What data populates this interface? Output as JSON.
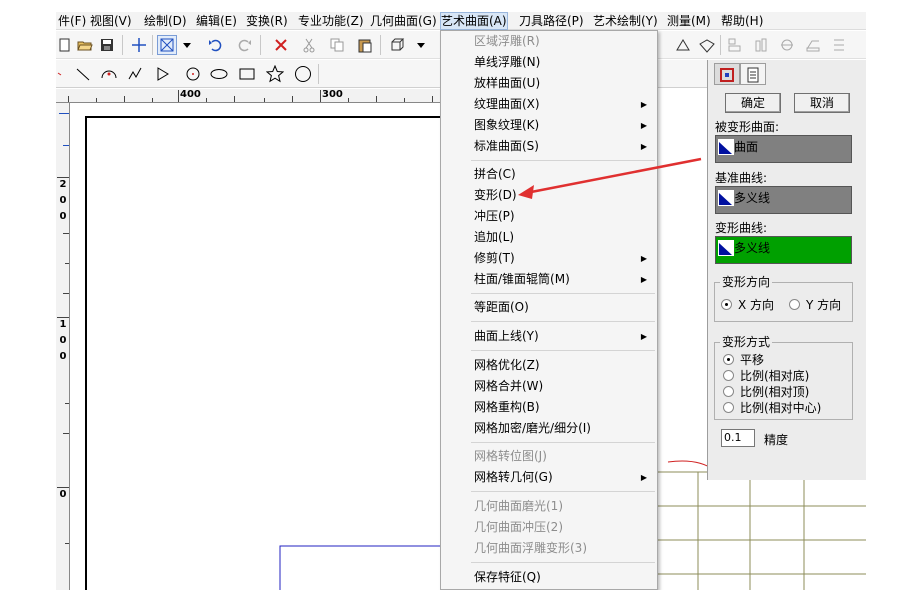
{
  "menubar": {
    "items": [
      {
        "label": "件(F)"
      },
      {
        "label": "视图(V)"
      },
      {
        "label": "绘制(D)"
      },
      {
        "label": "编辑(E)"
      },
      {
        "label": "变换(R)"
      },
      {
        "label": "专业功能(Z)"
      },
      {
        "label": "几何曲面(G)"
      },
      {
        "label": "艺术曲面(A)"
      },
      {
        "label": "刀具路径(P)"
      },
      {
        "label": "艺术绘制(Y)"
      },
      {
        "label": "测量(M)"
      },
      {
        "label": "帮助(H)"
      }
    ]
  },
  "toolbar": {
    "row1_icons": [
      "open-file-icon",
      "save-icon",
      "crosshair-icon",
      "select-box-icon",
      "dropdown-arrow-icon",
      "undo-icon",
      "redo-icon",
      "delete-icon",
      "cut-icon",
      "copy-icon",
      "paste-icon",
      "cube-view-icon",
      "dropdown-arrow-icon"
    ],
    "row2_icons": [
      "line-icon",
      "arc-icon",
      "polyline-icon",
      "polygon-open-icon",
      "circle-dot-icon",
      "ellipse-icon",
      "rectangle-icon",
      "star-icon",
      "circle-icon"
    ]
  },
  "ruler": {
    "top_labels": [
      "400",
      "300"
    ],
    "left_labels": [
      {
        "chars": [
          "2",
          "0",
          "0"
        ]
      },
      {
        "chars": [
          "1",
          "0",
          "0"
        ]
      },
      {
        "chars": [
          "0"
        ]
      }
    ]
  },
  "dropdown": {
    "items": [
      {
        "label": "区域浮雕(R)",
        "disabled": true,
        "submenu": false
      },
      {
        "label": "单线浮雕(N)",
        "disabled": false,
        "submenu": false
      },
      {
        "label": "放样曲面(U)",
        "disabled": false,
        "submenu": false
      },
      {
        "label": "纹理曲面(X)",
        "disabled": false,
        "submenu": true
      },
      {
        "label": "图象纹理(K)",
        "disabled": false,
        "submenu": true
      },
      {
        "label": "标准曲面(S)",
        "disabled": false,
        "submenu": true
      },
      {
        "label": "拼合(C)",
        "disabled": false,
        "submenu": false
      },
      {
        "label": "变形(D)",
        "disabled": false,
        "submenu": false
      },
      {
        "label": "冲压(P)",
        "disabled": false,
        "submenu": false
      },
      {
        "label": "追加(L)",
        "disabled": false,
        "submenu": false
      },
      {
        "label": "修剪(T)",
        "disabled": false,
        "submenu": true
      },
      {
        "label": "柱面/锥面辊筒(M)",
        "disabled": false,
        "submenu": true
      },
      {
        "label": "等距面(O)",
        "disabled": false,
        "submenu": false
      },
      {
        "label": "曲面上线(Y)",
        "disabled": false,
        "submenu": true
      },
      {
        "label": "网格优化(Z)",
        "disabled": false,
        "submenu": false
      },
      {
        "label": "网格合并(W)",
        "disabled": false,
        "submenu": false
      },
      {
        "label": "网格重构(B)",
        "disabled": false,
        "submenu": false
      },
      {
        "label": "网格加密/磨光/细分(I)",
        "disabled": false,
        "submenu": false
      },
      {
        "label": "网格转位图(J)",
        "disabled": true,
        "submenu": false
      },
      {
        "label": "网格转几何(G)",
        "disabled": false,
        "submenu": true
      },
      {
        "label": "几何曲面磨光(1)",
        "disabled": true,
        "submenu": false
      },
      {
        "label": "几何曲面冲压(2)",
        "disabled": true,
        "submenu": false
      },
      {
        "label": "几何曲面浮雕变形(3)",
        "disabled": true,
        "submenu": false
      },
      {
        "label": "保存特征(Q)",
        "disabled": false,
        "submenu": false
      }
    ],
    "submenu_arrow": "▶"
  },
  "panel": {
    "ok_label": "确定",
    "cancel_label": "取消",
    "deformed_surface": {
      "label": "被变形曲面:",
      "value": "曲面",
      "color": "#808080"
    },
    "base_curve": {
      "label": "基准曲线:",
      "value": "多义线",
      "color": "#808080"
    },
    "deform_curve": {
      "label": "变形曲线:",
      "value": "多义线",
      "color": "#00a000"
    },
    "direction": {
      "title": "变形方向",
      "options": [
        {
          "label": "X 方向",
          "selected": true
        },
        {
          "label": "Y 方向",
          "selected": false
        }
      ]
    },
    "mode": {
      "title": "变形方式",
      "options": [
        {
          "label": "平移",
          "selected": true
        },
        {
          "label": "比例(相对底)",
          "selected": false
        },
        {
          "label": "比例(相对顶)",
          "selected": false
        },
        {
          "label": "比例(相对中心)",
          "selected": false
        }
      ]
    },
    "precision_value": "0.1",
    "precision_label": "精度"
  },
  "colors": {
    "arrow": "#e03030",
    "grid": "#8c8c5a",
    "drawn_rect": "#2020c0",
    "field_green": "#00a000",
    "field_gray": "#808080"
  }
}
